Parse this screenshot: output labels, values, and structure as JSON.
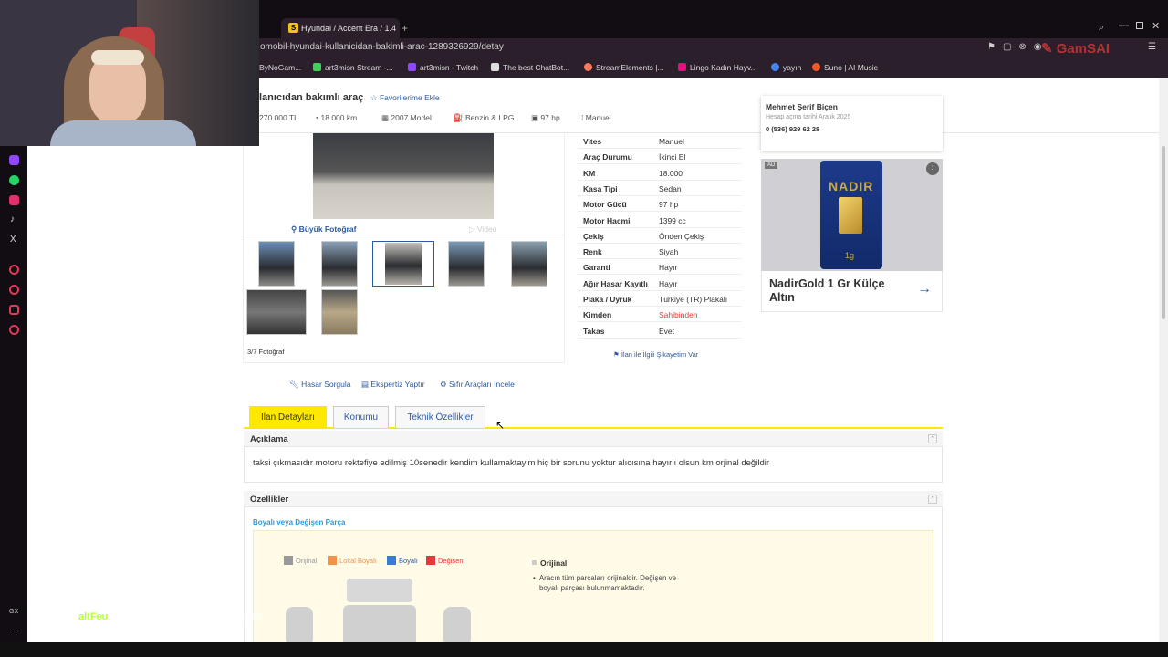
{
  "browser": {
    "tab_title": "Hyundai / Accent Era / 1.4",
    "tab_favicon": "S",
    "url": "omobil-hyundai-kullanicidan-bakimli-arac-1289326929/detay",
    "bookmarks": [
      "ByNoGam...",
      "art3misn Stream -...",
      "art3misn - Twitch",
      "The best ChatBot...",
      "StreamElements |...",
      "Lingo Kadın Hayv...",
      "yayın",
      "Suno | AI Music"
    ]
  },
  "listing": {
    "title": "lanıcıdan bakımlı araç",
    "favorite_label": "Favorilerime Ekle",
    "summary": [
      "270.000 TL",
      "18.000 km",
      "2007 Model",
      "Benzin & LPG",
      "97 hp",
      "Manuel"
    ]
  },
  "seller": {
    "name": "Mehmet Şerif Biçen",
    "joined": "Hesap açma tarihi  Aralık 2025",
    "phone": "0 (536) 929 62 28"
  },
  "gallery": {
    "big_photo": "Büyük Fotoğraf",
    "video": "Video",
    "counter": "3/7 Fotoğraf"
  },
  "specs": [
    {
      "k": "Vites",
      "v": "Manuel"
    },
    {
      "k": "Araç Durumu",
      "v": "İkinci El"
    },
    {
      "k": "KM",
      "v": "18.000"
    },
    {
      "k": "Kasa Tipi",
      "v": "Sedan"
    },
    {
      "k": "Motor Gücü",
      "v": "97 hp"
    },
    {
      "k": "Motor Hacmi",
      "v": "1399 cc"
    },
    {
      "k": "Çekiş",
      "v": "Önden Çekiş"
    },
    {
      "k": "Renk",
      "v": "Siyah"
    },
    {
      "k": "Garanti",
      "v": "Hayır"
    },
    {
      "k": "Ağır Hasar Kayıtlı",
      "v": "Hayır"
    },
    {
      "k": "Plaka / Uyruk",
      "v": "Türkiye (TR) Plakalı"
    },
    {
      "k": "Kimden",
      "v": "Sahibinden"
    },
    {
      "k": "Takas",
      "v": "Evet"
    }
  ],
  "complaint": "İlan ile İlgili Şikayetim Var",
  "ad": {
    "badge": "AD",
    "brand": "NADIR",
    "product": "1g",
    "title": "NadirGold 1 Gr Külçe Altın"
  },
  "actions": [
    "Hasar Sorgula",
    "Ekspertiz Yaptır",
    "Sıfır Araçları İncele"
  ],
  "tabs": [
    "İlan Detayları",
    "Konumu",
    "Teknik Özellikler"
  ],
  "description": {
    "heading": "Açıklama",
    "text": "taksi çıkmasıdır motoru rektefiye edilmiş 10senedir kendim kullamaktayim hiç bir sorunu yoktur alıcısına hayırlı olsun km orjinal değildir"
  },
  "features": {
    "heading": "Özellikler",
    "sub": "Boyalı veya Değişen Parça",
    "legend": [
      "Orijinal",
      "Lokal Boyalı",
      "Boyalı",
      "Değişen"
    ],
    "status_title": "Orijinal",
    "status_text_1": "Aracın tüm parçaları orijinaldir. Değişen ve",
    "status_text_2": "boyalı parçası bulunmamaktadır."
  },
  "colors": {
    "accent": "#ffe800",
    "link": "#2c5aa0",
    "red": "#e03a3a"
  },
  "overlay": {
    "chat_user": "altFeu",
    "sidebar_gx": "GX"
  }
}
